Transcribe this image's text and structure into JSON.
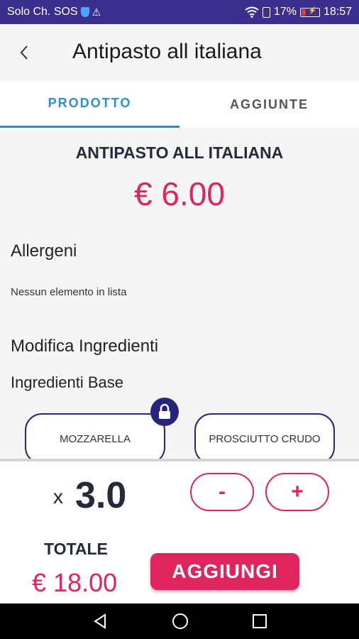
{
  "status_bar": {
    "carrier": "Solo Ch. SOS",
    "battery": "17%",
    "time": "18:57",
    "icons": [
      "shield-icon",
      "warning-icon",
      "wifi-icon",
      "sim-icon",
      "battery-icon"
    ]
  },
  "app_bar": {
    "title": "Antipasto all italiana",
    "back_icon": "chevron-left-icon"
  },
  "tabs": [
    {
      "label": "PRODOTTO",
      "active": true
    },
    {
      "label": "AGGIUNTE",
      "active": false
    }
  ],
  "product": {
    "name": "ANTIPASTO ALL ITALIANA",
    "price": "€ 6.00"
  },
  "allergens": {
    "title": "Allergeni",
    "empty_text": "Nessun elemento in lista"
  },
  "ingredients": {
    "title": "Modifica Ingredienti",
    "base_title": "Ingredienti Base",
    "items": [
      {
        "label": "MOZZARELLA",
        "locked": true
      },
      {
        "label": "PROSCIUTTO CRUDO",
        "locked": false
      }
    ]
  },
  "order": {
    "qty_prefix": "x",
    "quantity": "3.0",
    "minus_label": "-",
    "plus_label": "+",
    "total_label": "TOTALE",
    "total_value": "€ 18.00",
    "add_label": "AGGIUNGI"
  },
  "colors": {
    "accent": "#e0245e",
    "tab_active": "#2d8ed6",
    "chip_border": "#27257a",
    "status_bar": "#3a2f8f"
  }
}
